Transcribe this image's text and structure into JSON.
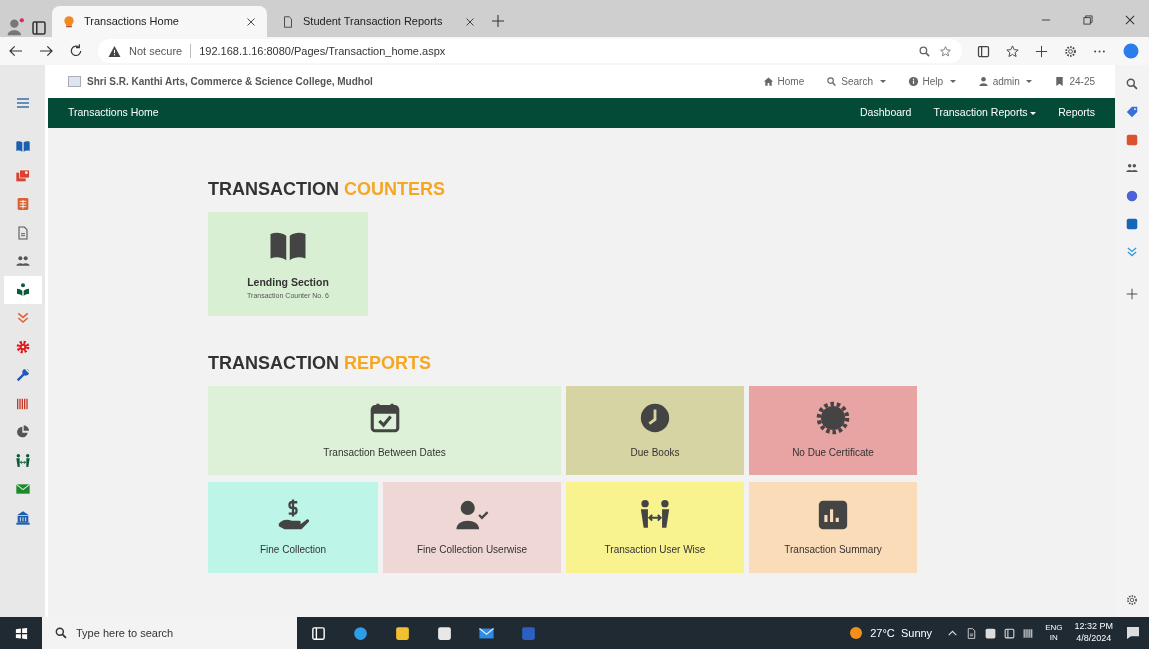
{
  "browser": {
    "tabs": [
      {
        "title": "Transactions Home",
        "selected": true,
        "kind": "site"
      },
      {
        "title": "Student Transaction Reports",
        "selected": false,
        "kind": "doc"
      }
    ],
    "address": {
      "security": "Not secure",
      "url": "192.168.1.16:8080/Pages/Transaction_home.aspx"
    }
  },
  "sidebar": {
    "items": [
      {
        "kind": "book",
        "selected": false
      },
      {
        "kind": "images",
        "selected": false
      },
      {
        "kind": "grid",
        "selected": false
      },
      {
        "kind": "document",
        "selected": false
      },
      {
        "kind": "people",
        "selected": false
      },
      {
        "kind": "reader",
        "selected": true
      },
      {
        "kind": "chevrons",
        "selected": false
      },
      {
        "kind": "gear",
        "selected": false
      },
      {
        "kind": "wrench",
        "selected": false
      },
      {
        "kind": "barcode",
        "selected": false
      },
      {
        "kind": "pie",
        "selected": false
      },
      {
        "kind": "exchange",
        "selected": false
      },
      {
        "kind": "envelope",
        "selected": false
      },
      {
        "kind": "building",
        "selected": false
      }
    ]
  },
  "header": {
    "brand": "Shri S.R. Kanthi Arts, Commerce & Science College, Mudhol",
    "menu": [
      {
        "label": "Home",
        "kind": "home",
        "dropdown": false
      },
      {
        "label": "Search",
        "kind": "search",
        "dropdown": true
      },
      {
        "label": "Help",
        "kind": "info",
        "dropdown": true
      },
      {
        "label": "admin",
        "kind": "user",
        "dropdown": true
      },
      {
        "label": "24-25",
        "kind": "bookmark",
        "dropdown": false
      }
    ]
  },
  "navbar": {
    "brand": "Transactions Home",
    "links": [
      {
        "label": "Dashboard",
        "dropdown": false
      },
      {
        "label": "Transaction Reports",
        "dropdown": true
      },
      {
        "label": "Reports",
        "dropdown": false
      }
    ]
  },
  "counters": {
    "title": "TRANSACTION",
    "title_accent": "COUNTERS",
    "tiles": [
      {
        "title": "Lending Section",
        "subtitle": "Transaction Counter No. 6",
        "kind": "book",
        "color": "#d9efd3"
      }
    ]
  },
  "reports": {
    "title": "TRANSACTION",
    "title_accent": "REPORTS",
    "tiles": [
      {
        "label": "Transaction Between Dates",
        "kind": "calendar",
        "color": "#dcf1d8",
        "wide": true
      },
      {
        "label": "Due Books",
        "kind": "clock",
        "color": "#d7d4a3",
        "wide": false
      },
      {
        "label": "No Due Certificate",
        "kind": "seal",
        "color": "#e8a3a3",
        "wide": false
      },
      {
        "label": "Fine Collection",
        "kind": "money",
        "color": "#bdf5e8",
        "wide": false
      },
      {
        "label": "Fine Collection Userwise",
        "kind": "usercheck",
        "color": "#efd7d5",
        "wide": false
      },
      {
        "label": "Transaction User Wise",
        "kind": "exchange",
        "color": "#f8f28f",
        "wide": false
      },
      {
        "label": "Transaction Summary",
        "kind": "chart",
        "color": "#fbdcb9",
        "wide": false
      }
    ]
  },
  "taskbar": {
    "search_placeholder": "Type here to search",
    "weather": "27°C  Sunny",
    "lang": "ENG",
    "region": "IN",
    "time": "12:32 PM",
    "date": "4/8/2024"
  }
}
